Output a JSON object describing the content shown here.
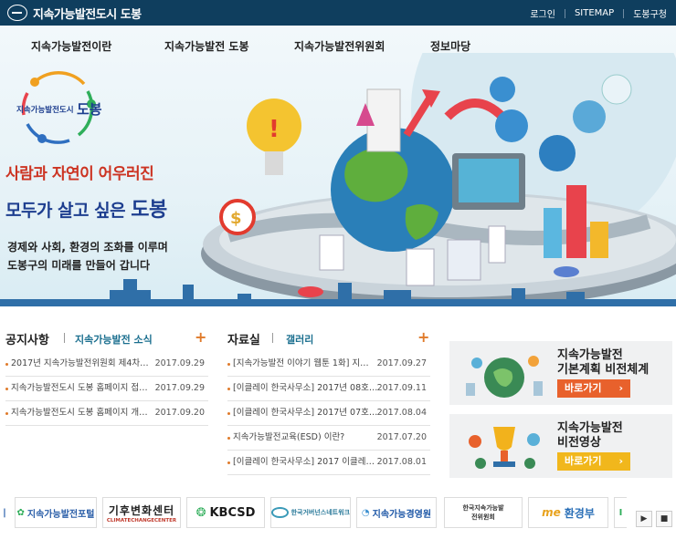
{
  "header": {
    "logo_text": "지속가능발전도시 도봉",
    "util_links": [
      "로그인",
      "SITEMAP",
      "도봉구청"
    ]
  },
  "gnb": [
    "지속가능발전이란",
    "지속가능발전 도봉",
    "지속가능발전위원회",
    "정보마당"
  ],
  "hero": {
    "emblem_text": "지속가능발전도시",
    "emblem_big": "도봉",
    "slogan_line1": "사람과 자연이 어우러진",
    "slogan_line2_a": "모두가 살고 싶은 ",
    "slogan_line2_b": "도봉",
    "sub_line1": "경제와 사회, 환경의 조화를 이루며",
    "sub_line2": "도봉구의 미래를 만들어 갑니다"
  },
  "notice": {
    "title": "공지사항",
    "tab": "지속가능발전 소식",
    "items": [
      {
        "title": "2017년 지속가능발전위원회 제4차…",
        "date": "2017.09.29"
      },
      {
        "title": "지속가능발전도시 도봉 홈페이지 접…",
        "date": "2017.09.29"
      },
      {
        "title": "지속가능발전도시 도봉 홈페이지 개…",
        "date": "2017.09.20"
      }
    ]
  },
  "archive": {
    "title": "자료실",
    "tab": "갤러리",
    "items": [
      {
        "title": "[지속가능발전 이야기 웹툰 1화] 지…",
        "date": "2017.09.27"
      },
      {
        "title": "[이클레이 한국사무소] 2017년 08호…",
        "date": "2017.09.11"
      },
      {
        "title": "[이클레이 한국사무소] 2017년 07호…",
        "date": "2017.08.04"
      },
      {
        "title": "지속가능발전교육(ESD) 이란?",
        "date": "2017.07.20"
      },
      {
        "title": "[이클레이 한국사무소] 2017 이클레…",
        "date": "2017.08.01"
      }
    ]
  },
  "promos": [
    {
      "title1": "지속가능발전",
      "title2": "기본계획 비전체계",
      "button": "바로가기",
      "color": "#e8612c"
    },
    {
      "title1": "지속가능발전",
      "title2": "비전영상",
      "button": "바로가기",
      "color": "#f1b71c"
    }
  ],
  "banners": [
    {
      "label": "지속가능발전포털",
      "color": "#2a5ea8"
    },
    {
      "label": "기후변화센터",
      "sub": "CLIMATECHANGECENTER",
      "color": "#222222"
    },
    {
      "label": "KBCSD",
      "color": "#1a1a1a"
    },
    {
      "label": "한국거버넌스네트워크",
      "color": "#2a7a9a"
    },
    {
      "label": "지속가능경영원",
      "color": "#1c56a6"
    },
    {
      "label": "한국지속가능발전위원회",
      "color": "#333333"
    },
    {
      "label": "환경부",
      "color": "#2a6fb7"
    }
  ],
  "banner_controls": [
    "play-icon",
    "stop-icon"
  ],
  "colors": {
    "topbar": "#0f3e5e",
    "accent_orange": "#e07a2a",
    "tab_teal": "#1b6f8f"
  }
}
